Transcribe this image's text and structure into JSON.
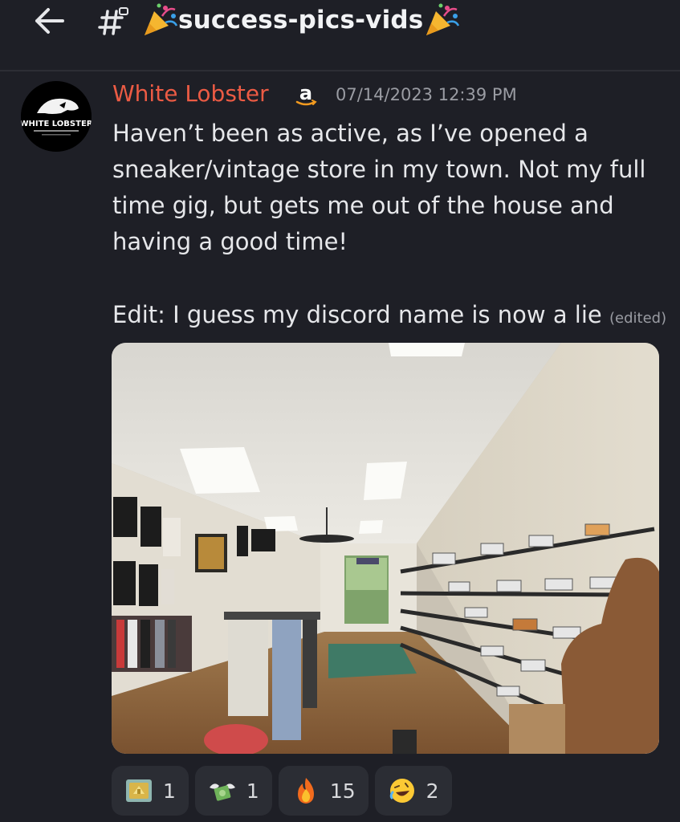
{
  "channel": {
    "name": "success-pics-vids"
  },
  "avatar": {
    "text": "WHITE LOBSTER"
  },
  "message": {
    "author": "White Lobster",
    "timestamp": "07/14/2023 12:39 PM",
    "body": "Haven’t been as active, as I’ve opened a\nsneaker/vintage store in my town. Not my full\ntime gig, but gets me out of the house and\nhaving a good time!",
    "edit_text": "Edit: I guess my discord name is now a lie",
    "edited_label": "(edited)"
  },
  "reactions": [
    {
      "icon": "gold-coin-emoji",
      "count": "1"
    },
    {
      "icon": "money-with-wings-emoji",
      "count": "1"
    },
    {
      "icon": "fire-emoji",
      "count": "15"
    },
    {
      "icon": "rofl-emoji",
      "count": "2"
    }
  ],
  "colors": {
    "background": "#1e1f26",
    "author": "#ec5b44",
    "reaction_bg": "#2b2d34"
  }
}
